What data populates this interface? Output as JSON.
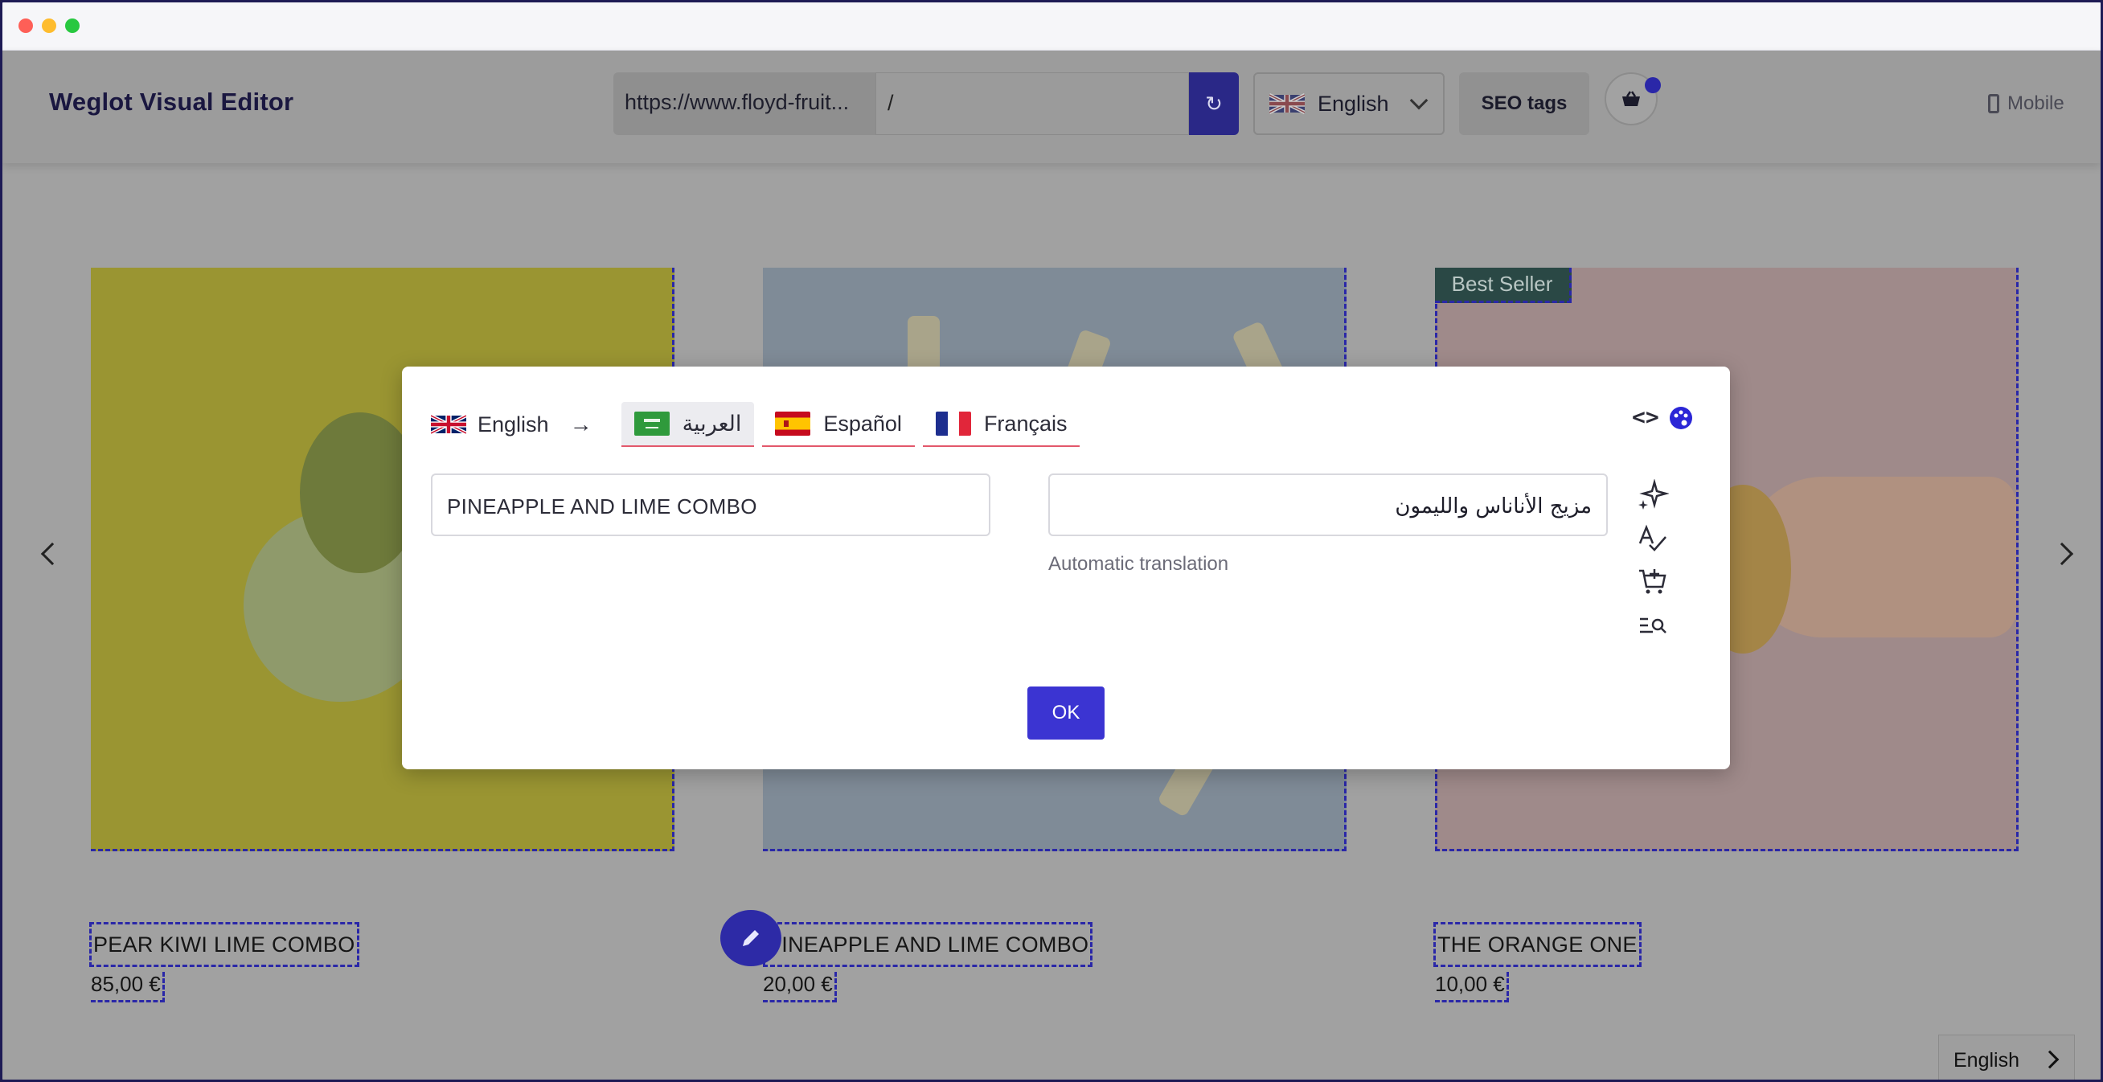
{
  "topbar": {
    "brand": "Weglot Visual Editor",
    "url": "https://www.floyd-fruit...",
    "path": "/",
    "language": "English",
    "seo_label": "SEO tags",
    "mobile_label": "Mobile"
  },
  "products": [
    {
      "title": "PEAR KIWI LIME COMBO",
      "price": "85,00 €"
    },
    {
      "title": "PINEAPPLE AND LIME COMBO",
      "price": "20,00 €"
    },
    {
      "title": "THE ORANGE ONE",
      "price": "10,00 €",
      "badge": "Best Seller"
    }
  ],
  "lang_switcher": "English",
  "modal": {
    "source_language": "English",
    "arrow": "→",
    "target_languages": [
      {
        "label": "العربية",
        "active": true
      },
      {
        "label": "Español",
        "active": false
      },
      {
        "label": "Français",
        "active": false
      }
    ],
    "source_text": "PINEAPPLE AND LIME COMBO",
    "translated_text": "مزيج الأناناس والليمون",
    "note": "Automatic translation",
    "ok_label": "OK",
    "code_icon": "<>"
  },
  "colors": {
    "accent": "#3b34d2",
    "tab_underline": "#e3586b",
    "dashed_outline": "#2a27a8"
  }
}
